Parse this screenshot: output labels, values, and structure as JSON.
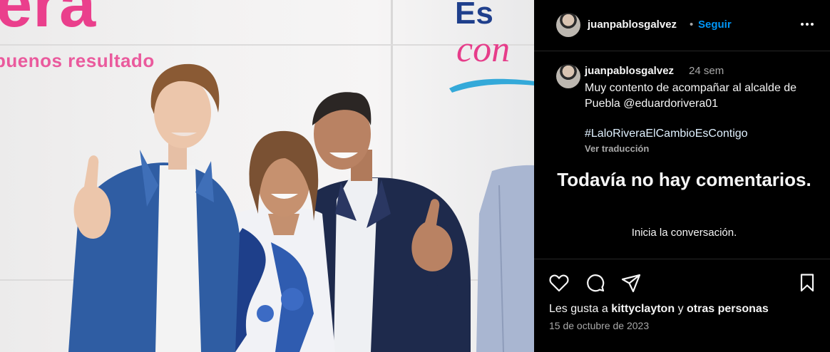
{
  "photo": {
    "brand_big": "era",
    "brand_sub": "buenos resultado",
    "brand_es": "Es",
    "brand_con": "con"
  },
  "header": {
    "username": "juanpablosgalvez",
    "separator": "•",
    "follow_label": "Seguir",
    "more_icon": "more-horizontal-icon"
  },
  "caption": {
    "username": "juanpablosgalvez",
    "time": "24 sem",
    "text": "Muy contento de acompañar al alcalde de Puebla @eduardorivera01",
    "hashtag": "#LaloRiveraElCambioEsContigo",
    "translate_label": "Ver traducción"
  },
  "comments": {
    "empty_title": "Todavía no hay comentarios.",
    "empty_subtitle": "Inicia la conversación."
  },
  "actions": {
    "icons": [
      "heart-icon",
      "comment-icon",
      "share-icon",
      "bookmark-icon"
    ]
  },
  "likes": {
    "prefix": "Les gusta a",
    "user": "kittyclayton",
    "middle": "y",
    "others": "otras personas"
  },
  "date": "15 de octubre de 2023",
  "colors": {
    "background": "#000000",
    "text": "#f5f5f5",
    "muted": "#a8a8a8",
    "link": "#0095f6",
    "brand_pink": "#ea3f8c",
    "brand_blue": "#1f3f8c"
  }
}
